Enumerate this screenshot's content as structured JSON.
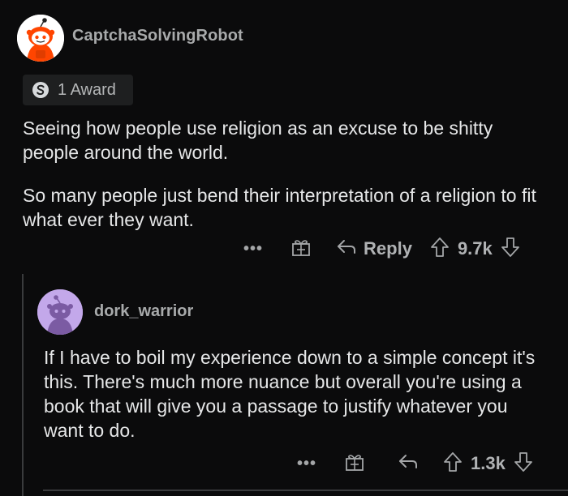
{
  "comment": {
    "username": "CaptchaSolvingRobot",
    "award_label": "1 Award",
    "paragraph1": "Seeing how people use religion as an excuse to be shitty people around the world.",
    "paragraph2": "So many people just bend their interpretation of a religion to fit what ever they want.",
    "actions": {
      "more": "•••",
      "reply_label": "Reply",
      "score": "9.7k"
    }
  },
  "reply": {
    "username": "dork_warrior",
    "paragraph": "If I have to boil my experience down to a simple concept it's this. There's much more nuance but overall you're using a book that will give you a passage to justify whatever you want to do.",
    "actions": {
      "more": "•••",
      "score": "1.3k"
    }
  },
  "colors": {
    "background": "#0b0b0c",
    "text": "#e6e7e8",
    "muted": "#a8aaab",
    "snoo_orange": "#ff4500",
    "avatar2_bg": "#c3a8ea"
  },
  "icons": {
    "award": "award-icon",
    "gift": "gift-icon",
    "reply": "reply-arrow-icon",
    "upvote": "upvote-arrow-icon",
    "downvote": "downvote-arrow-icon"
  }
}
